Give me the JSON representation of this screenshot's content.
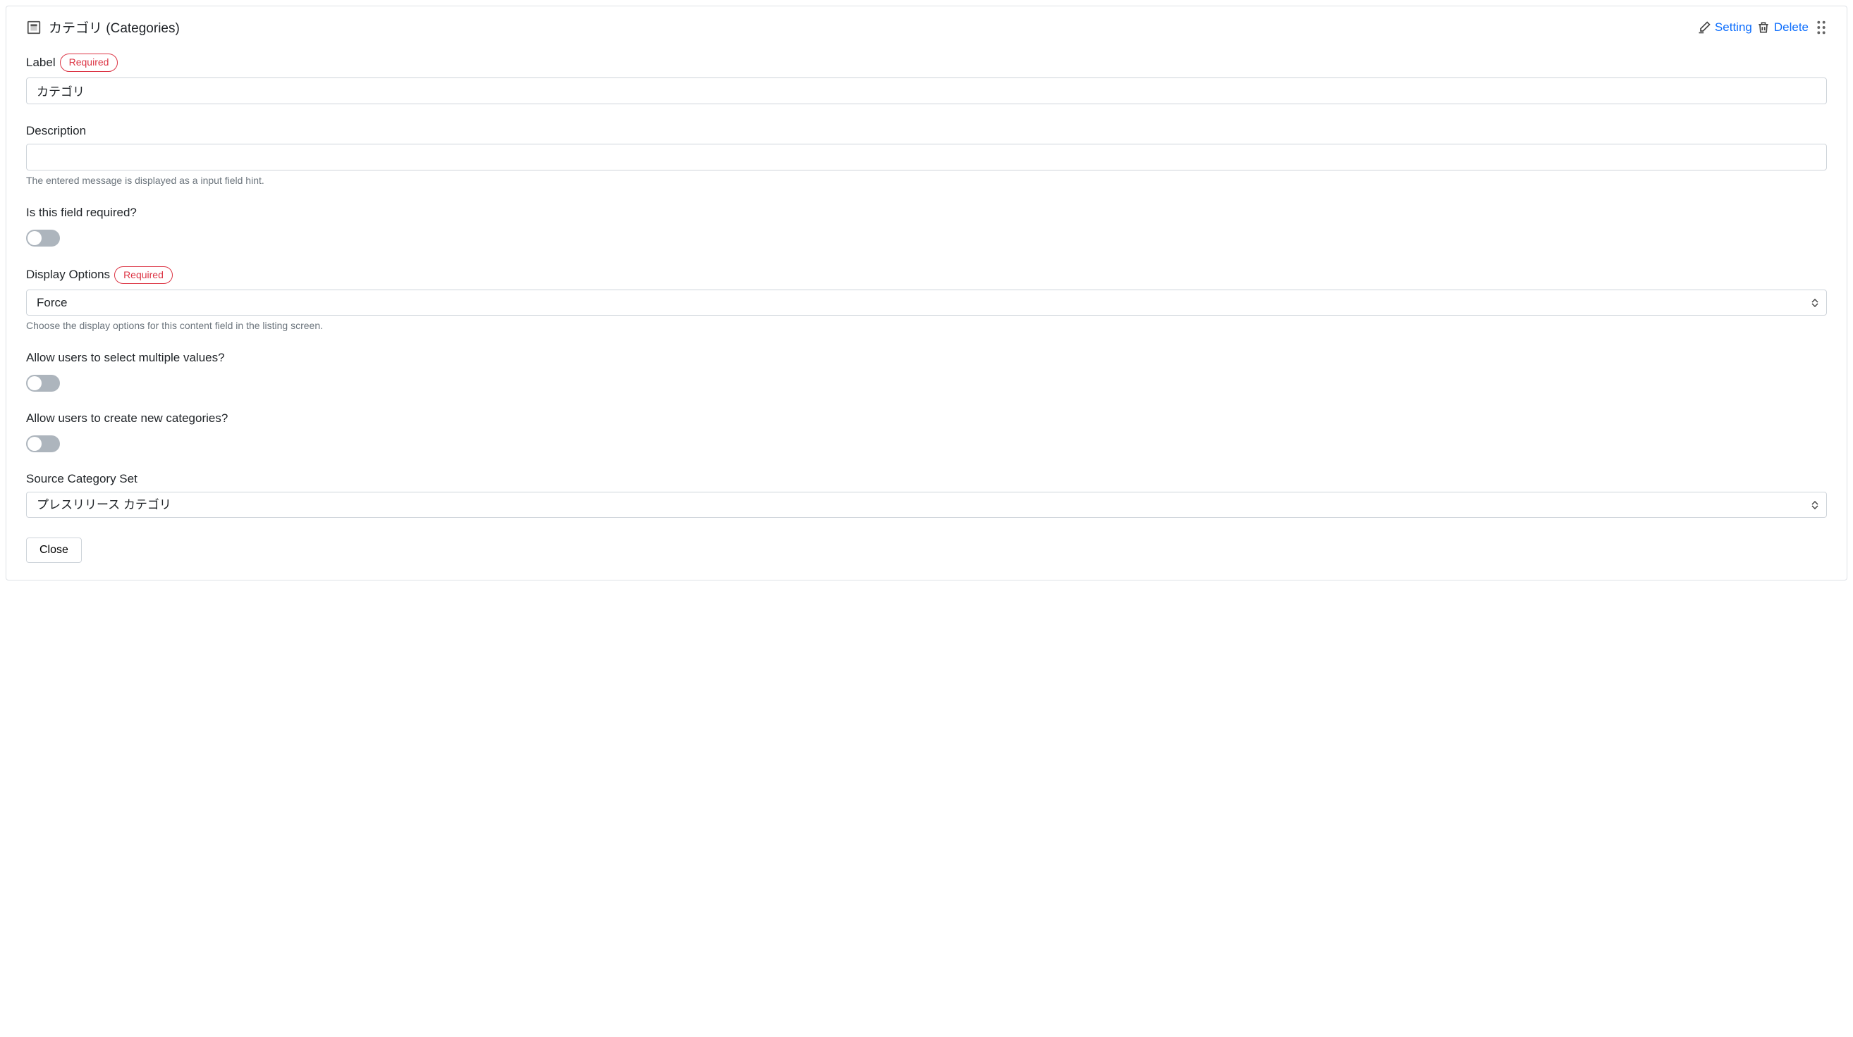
{
  "header": {
    "title": "カテゴリ (Categories)",
    "actions": {
      "setting": "Setting",
      "delete": "Delete"
    }
  },
  "badges": {
    "required": "Required"
  },
  "fields": {
    "label": {
      "label": "Label",
      "value": "カテゴリ"
    },
    "description": {
      "label": "Description",
      "value": "",
      "hint": "The entered message is displayed as a input field hint."
    },
    "required_toggle": {
      "label": "Is this field required?",
      "value": false
    },
    "display_options": {
      "label": "Display Options",
      "value": "Force",
      "hint": "Choose the display options for this content field in the listing screen."
    },
    "multiple_values": {
      "label": "Allow users to select multiple values?",
      "value": false
    },
    "create_categories": {
      "label": "Allow users to create new categories?",
      "value": false
    },
    "source_set": {
      "label": "Source Category Set",
      "value": "プレスリリース カテゴリ"
    }
  },
  "buttons": {
    "close": "Close"
  }
}
